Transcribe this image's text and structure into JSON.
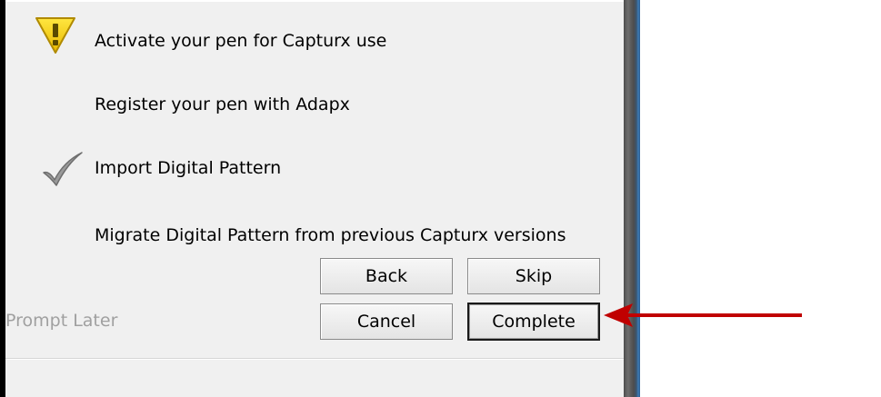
{
  "steps": [
    {
      "label": "Activate your pen for Capturx use",
      "status_icon": "warning-icon"
    },
    {
      "label": "Register your pen with Adapx",
      "status_icon": ""
    },
    {
      "label": "Import Digital Pattern",
      "status_icon": "checkmark-icon"
    },
    {
      "label": "Migrate Digital Pattern from previous Capturx versions",
      "status_icon": ""
    }
  ],
  "buttons": {
    "back": "Back",
    "skip": "Skip",
    "cancel": "Cancel",
    "complete": "Complete"
  },
  "prompt_later": "Prompt Later",
  "colors": {
    "dialog_bg": "#f0f0f0",
    "warning_fill": "#f5d000",
    "annotation_arrow": "#c00000",
    "disabled_text": "#a0a0a0"
  }
}
